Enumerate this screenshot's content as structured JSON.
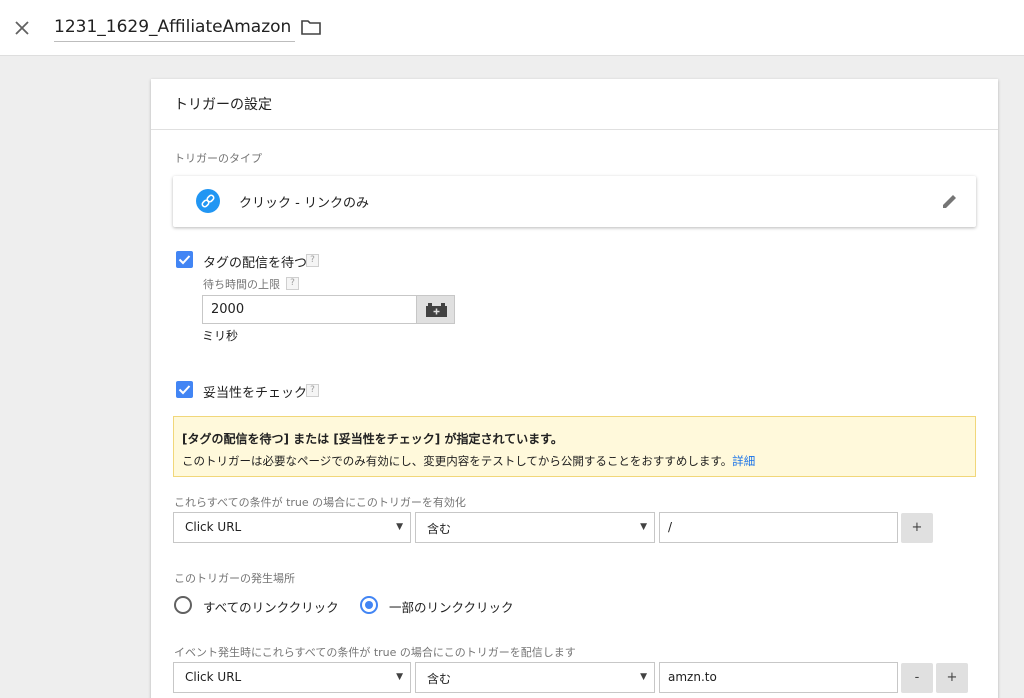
{
  "header": {
    "title": "1231_1629_AffiliateAmazon",
    "close_icon": "close-icon",
    "folder_icon": "folder-icon"
  },
  "card": {
    "title": "トリガーの設定",
    "trigger_type": {
      "section_label": "トリガーのタイプ",
      "value": "クリック - リンクのみ",
      "icon": "link-icon",
      "edit_icon": "pencil-icon"
    },
    "wait_for_tags": {
      "checked": true,
      "label": "タグの配信を待つ",
      "help": "?",
      "max_wait_label": "待ち時間の上限",
      "max_wait_help": "?",
      "max_wait_value": "2000",
      "unit": "ミリ秒",
      "variable_icon": "variable-block-icon"
    },
    "check_validation": {
      "checked": true,
      "label": "妥当性をチェック",
      "help": "?"
    },
    "notice": {
      "title": "[タグの配信を待つ] または [妥当性をチェック] が指定されています。",
      "body": "このトリガーは必要なページでのみ有効にし、変更内容をテストしてから公開することをおすすめします。",
      "link": "詳細"
    },
    "enable_conditions": {
      "label": "これらすべての条件が true の場合にこのトリガーを有効化",
      "variable": "Click URL",
      "operator": "含む",
      "value": "/",
      "add_label": "+"
    },
    "fire_on": {
      "label": "このトリガーの発生場所",
      "options": [
        {
          "label": "すべてのリンククリック",
          "selected": false
        },
        {
          "label": "一部のリンククリック",
          "selected": true
        }
      ]
    },
    "fire_conditions": {
      "label": "イベント発生時にこれらすべての条件が true の場合にこのトリガーを配信します",
      "variable": "Click URL",
      "operator": "含む",
      "value": "amzn.to",
      "remove_label": "-",
      "add_label": "+"
    }
  },
  "colors": {
    "accent": "#4285f4",
    "link_icon_bg": "#2196f3",
    "notice_bg": "#fff9db",
    "notice_border": "#f1d77a",
    "link": "#1a73e8"
  }
}
